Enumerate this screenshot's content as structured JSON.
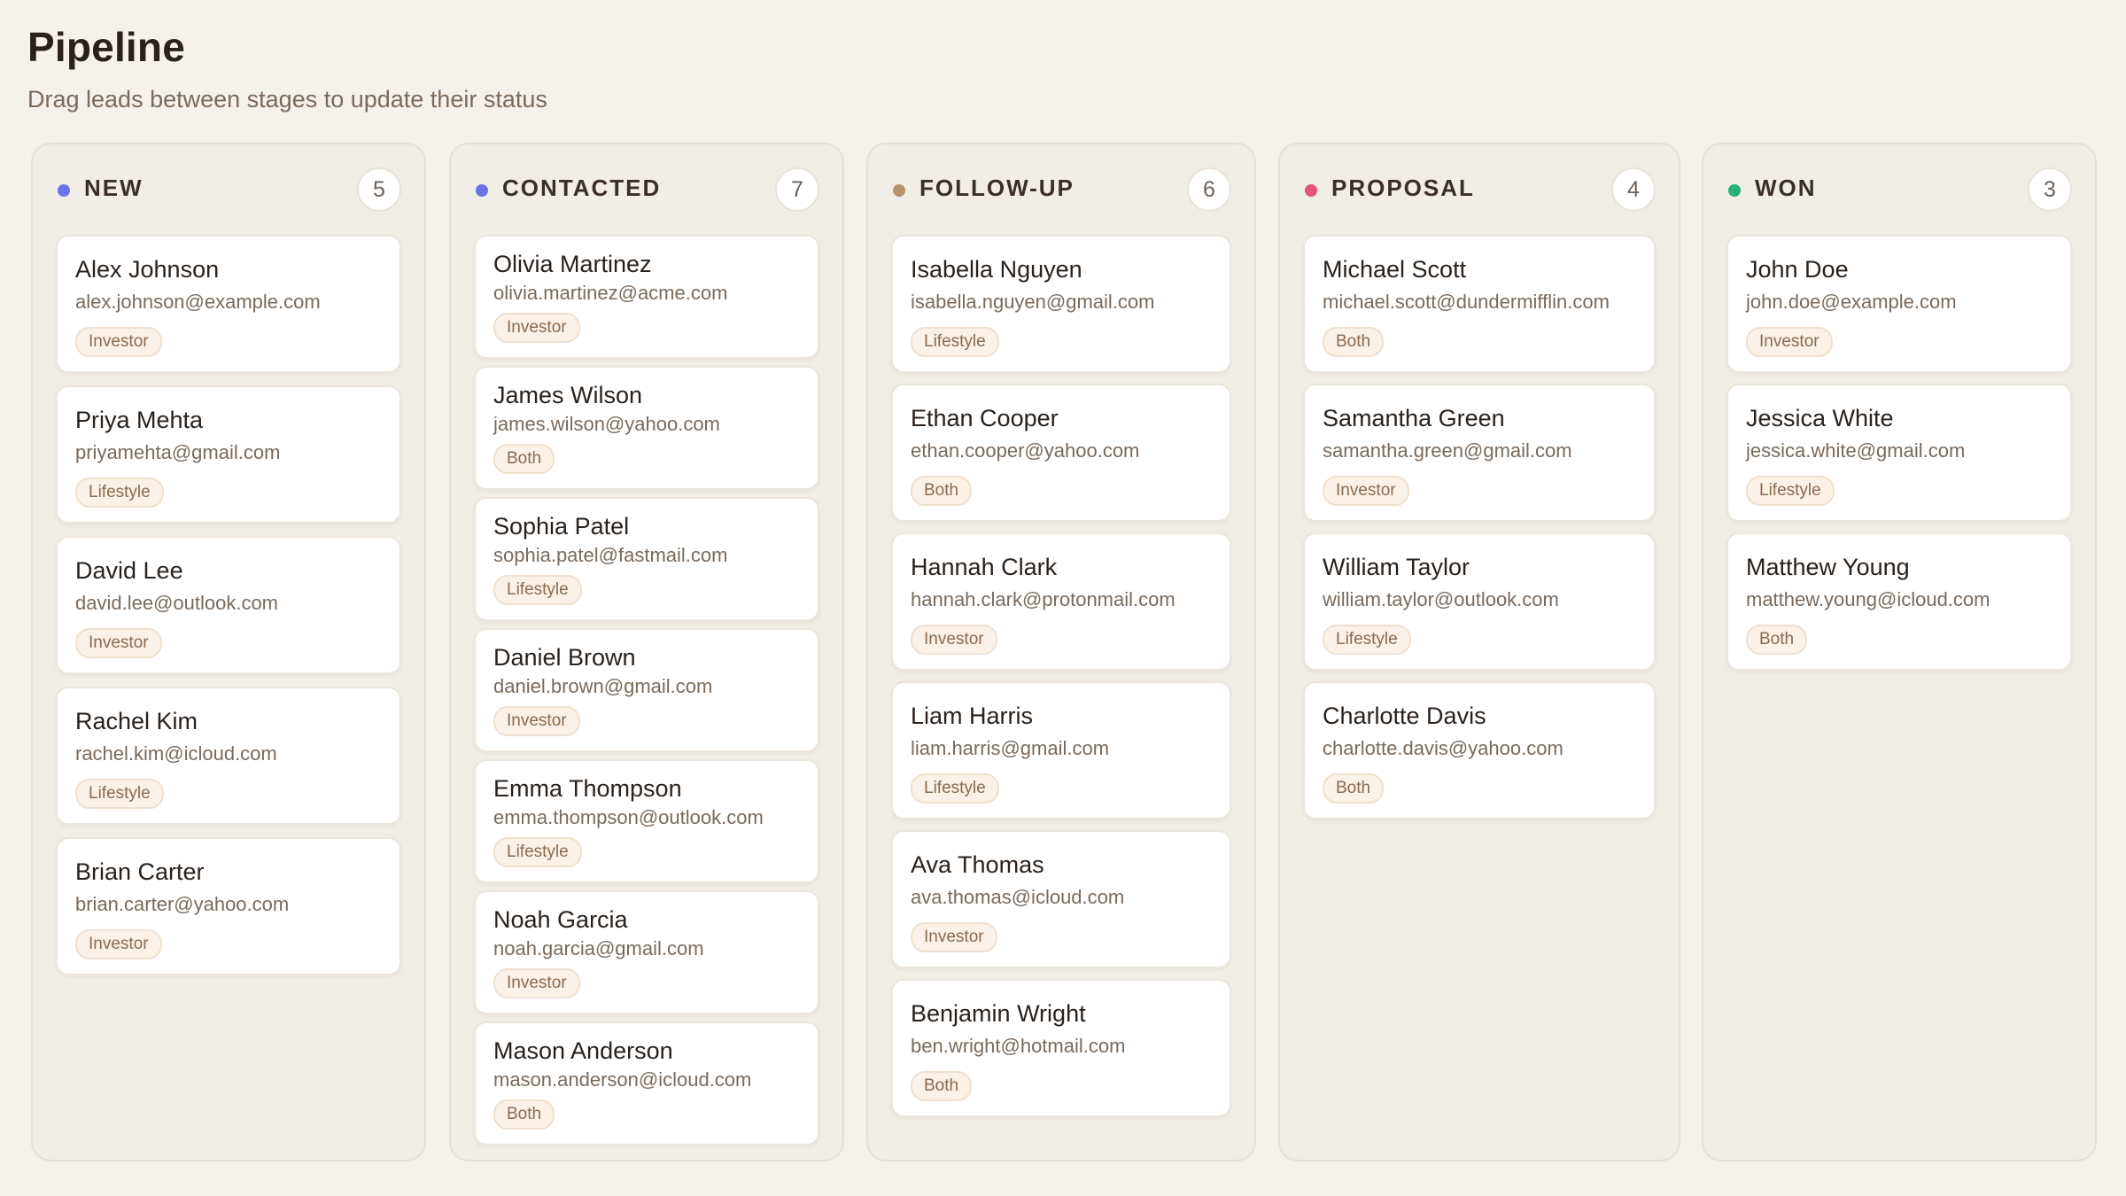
{
  "header": {
    "title": "Pipeline",
    "subtitle": "Drag leads between stages to update their status"
  },
  "colors": {
    "background": "#f5f1ec",
    "new": "#6b72e8",
    "contacted": "#6b72e8",
    "follow_up": "#b8926a",
    "proposal": "#e5527a",
    "won": "#27b07a"
  },
  "columns": [
    {
      "title": "NEW",
      "count": "5",
      "dot_color": "#6b72e8",
      "cards": [
        {
          "name": "Alex Johnson",
          "email": "alex.johnson@example.com",
          "tag": "Investor"
        },
        {
          "name": "Priya Mehta",
          "email": "priyamehta@gmail.com",
          "tag": "Lifestyle"
        },
        {
          "name": "David Lee",
          "email": "david.lee@outlook.com",
          "tag": "Investor"
        },
        {
          "name": "Rachel Kim",
          "email": "rachel.kim@icloud.com",
          "tag": "Lifestyle"
        },
        {
          "name": "Brian Carter",
          "email": "brian.carter@yahoo.com",
          "tag": "Investor"
        }
      ]
    },
    {
      "title": "CONTACTED",
      "count": "7",
      "dot_color": "#6b72e8",
      "cards": [
        {
          "name": "Olivia Martinez",
          "email": "olivia.martinez@acme.com",
          "tag": "Investor"
        },
        {
          "name": "James Wilson",
          "email": "james.wilson@yahoo.com",
          "tag": "Both"
        },
        {
          "name": "Sophia Patel",
          "email": "sophia.patel@fastmail.com",
          "tag": "Lifestyle"
        },
        {
          "name": "Daniel Brown",
          "email": "daniel.brown@gmail.com",
          "tag": "Investor"
        },
        {
          "name": "Emma Thompson",
          "email": "emma.thompson@outlook.com",
          "tag": "Lifestyle"
        },
        {
          "name": "Noah Garcia",
          "email": "noah.garcia@gmail.com",
          "tag": "Investor"
        },
        {
          "name": "Mason Anderson",
          "email": "mason.anderson@icloud.com",
          "tag": "Both"
        }
      ]
    },
    {
      "title": "FOLLOW-UP",
      "count": "6",
      "dot_color": "#b8926a",
      "cards": [
        {
          "name": "Isabella Nguyen",
          "email": "isabella.nguyen@gmail.com",
          "tag": "Lifestyle"
        },
        {
          "name": "Ethan Cooper",
          "email": "ethan.cooper@yahoo.com",
          "tag": "Both"
        },
        {
          "name": "Hannah Clark",
          "email": "hannah.clark@protonmail.com",
          "tag": "Investor"
        },
        {
          "name": "Liam Harris",
          "email": "liam.harris@gmail.com",
          "tag": "Lifestyle"
        },
        {
          "name": "Ava Thomas",
          "email": "ava.thomas@icloud.com",
          "tag": "Investor"
        },
        {
          "name": "Benjamin Wright",
          "email": "ben.wright@hotmail.com",
          "tag": "Both"
        }
      ]
    },
    {
      "title": "PROPOSAL",
      "count": "4",
      "dot_color": "#e5527a",
      "cards": [
        {
          "name": "Michael Scott",
          "email": "michael.scott@dundermifflin.com",
          "tag": "Both"
        },
        {
          "name": "Samantha Green",
          "email": "samantha.green@gmail.com",
          "tag": "Investor"
        },
        {
          "name": "William Taylor",
          "email": "william.taylor@outlook.com",
          "tag": "Lifestyle"
        },
        {
          "name": "Charlotte Davis",
          "email": "charlotte.davis@yahoo.com",
          "tag": "Both"
        }
      ]
    },
    {
      "title": "WON",
      "count": "3",
      "dot_color": "#27b07a",
      "cards": [
        {
          "name": "John Doe",
          "email": "john.doe@example.com",
          "tag": "Investor"
        },
        {
          "name": "Jessica White",
          "email": "jessica.white@gmail.com",
          "tag": "Lifestyle"
        },
        {
          "name": "Matthew Young",
          "email": "matthew.young@icloud.com",
          "tag": "Both"
        }
      ]
    }
  ]
}
